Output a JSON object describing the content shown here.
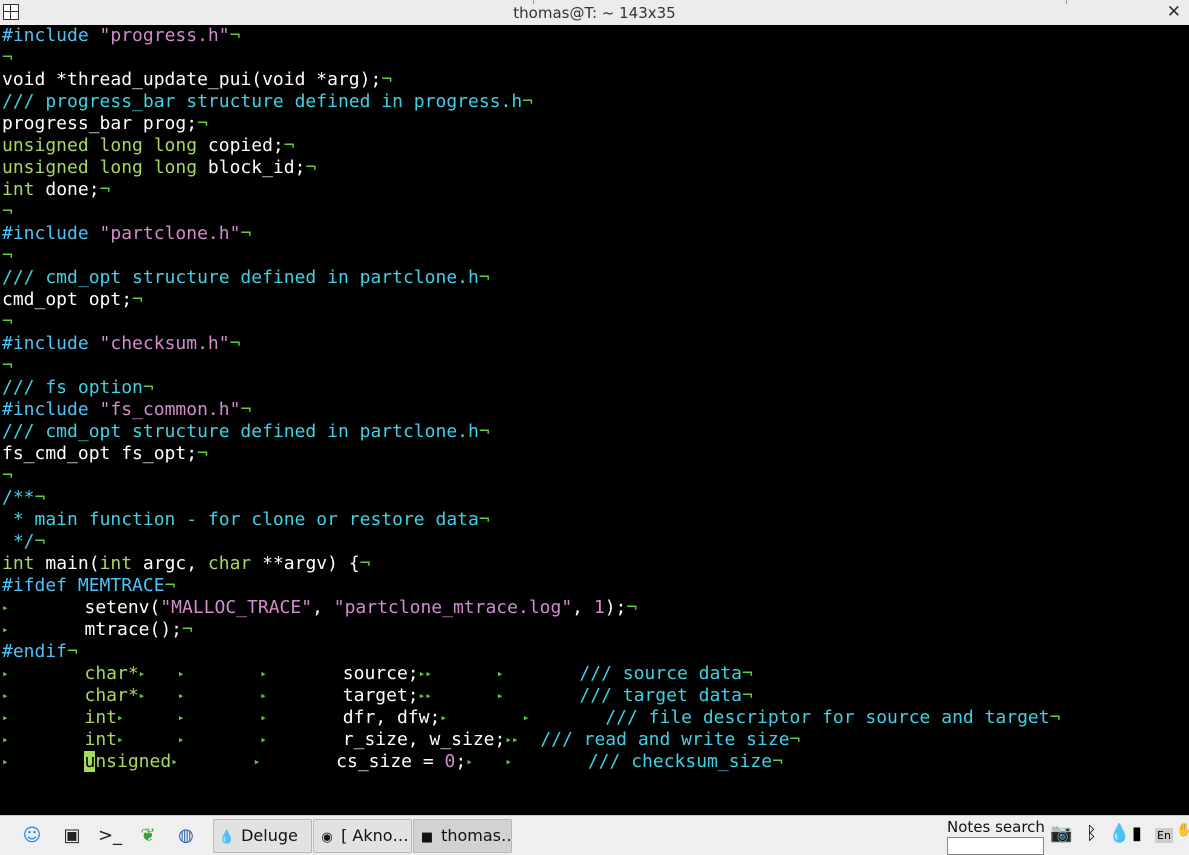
{
  "window": {
    "title": "thomas@T: ~ 143x35"
  },
  "editor": {
    "lines": [
      {
        "segs": [
          {
            "t": "#include ",
            "c": "pp"
          },
          {
            "t": "\"progress.h\"",
            "c": "str"
          },
          {
            "t": "¬",
            "c": "nl"
          }
        ]
      },
      {
        "segs": [
          {
            "t": "¬",
            "c": "nl"
          }
        ]
      },
      {
        "segs": [
          {
            "t": "void *thread_update_pui(void *arg);",
            "c": ""
          },
          {
            "t": "¬",
            "c": "nl"
          }
        ]
      },
      {
        "segs": [
          {
            "t": "/// progress_bar structure defined in progress.h",
            "c": "cm"
          },
          {
            "t": "¬",
            "c": "nl"
          }
        ]
      },
      {
        "segs": [
          {
            "t": "progress_bar prog;",
            "c": ""
          },
          {
            "t": "¬",
            "c": "nl"
          }
        ]
      },
      {
        "segs": [
          {
            "t": "unsigned long long",
            "c": "ty"
          },
          {
            "t": " copied;",
            "c": ""
          },
          {
            "t": "¬",
            "c": "nl"
          }
        ]
      },
      {
        "segs": [
          {
            "t": "unsigned long long",
            "c": "ty"
          },
          {
            "t": " block_id;",
            "c": ""
          },
          {
            "t": "¬",
            "c": "nl"
          }
        ]
      },
      {
        "segs": [
          {
            "t": "int",
            "c": "ty"
          },
          {
            "t": " done;",
            "c": ""
          },
          {
            "t": "¬",
            "c": "nl"
          }
        ]
      },
      {
        "segs": [
          {
            "t": "¬",
            "c": "nl"
          }
        ]
      },
      {
        "segs": [
          {
            "t": "#include ",
            "c": "pp"
          },
          {
            "t": "\"partclone.h\"",
            "c": "str"
          },
          {
            "t": "¬",
            "c": "nl"
          }
        ]
      },
      {
        "segs": [
          {
            "t": "¬",
            "c": "nl"
          }
        ]
      },
      {
        "segs": [
          {
            "t": "/// cmd_opt structure defined in partclone.h",
            "c": "cm"
          },
          {
            "t": "¬",
            "c": "nl"
          }
        ]
      },
      {
        "segs": [
          {
            "t": "cmd_opt opt;",
            "c": ""
          },
          {
            "t": "¬",
            "c": "nl"
          }
        ]
      },
      {
        "segs": [
          {
            "t": "¬",
            "c": "nl"
          }
        ]
      },
      {
        "segs": [
          {
            "t": "#include ",
            "c": "pp"
          },
          {
            "t": "\"checksum.h\"",
            "c": "str"
          },
          {
            "t": "¬",
            "c": "nl"
          }
        ]
      },
      {
        "segs": [
          {
            "t": "¬",
            "c": "nl"
          }
        ]
      },
      {
        "segs": [
          {
            "t": "/// fs option",
            "c": "cm"
          },
          {
            "t": "¬",
            "c": "nl"
          }
        ]
      },
      {
        "segs": [
          {
            "t": "#include ",
            "c": "pp"
          },
          {
            "t": "\"fs_common.h\"",
            "c": "str"
          },
          {
            "t": "¬",
            "c": "nl"
          }
        ]
      },
      {
        "segs": [
          {
            "t": "/// cmd_opt structure defined in partclone.h",
            "c": "cm"
          },
          {
            "t": "¬",
            "c": "nl"
          }
        ]
      },
      {
        "segs": [
          {
            "t": "fs_cmd_opt fs_opt;",
            "c": ""
          },
          {
            "t": "¬",
            "c": "nl"
          }
        ]
      },
      {
        "segs": [
          {
            "t": "¬",
            "c": "nl"
          }
        ]
      },
      {
        "segs": [
          {
            "t": "/**",
            "c": "cm"
          },
          {
            "t": "¬",
            "c": "nl"
          }
        ]
      },
      {
        "segs": [
          {
            "t": " * main function - for clone or restore data",
            "c": "cm"
          },
          {
            "t": "¬",
            "c": "nl"
          }
        ]
      },
      {
        "segs": [
          {
            "t": " */",
            "c": "cm"
          },
          {
            "t": "¬",
            "c": "nl"
          }
        ]
      },
      {
        "segs": [
          {
            "t": "int",
            "c": "ty"
          },
          {
            "t": " main(",
            "c": ""
          },
          {
            "t": "int",
            "c": "ty"
          },
          {
            "t": " argc, ",
            "c": ""
          },
          {
            "t": "char",
            "c": "ty"
          },
          {
            "t": " **argv) {",
            "c": ""
          },
          {
            "t": "¬",
            "c": "nl"
          }
        ]
      },
      {
        "segs": [
          {
            "t": "#ifdef MEMTRACE",
            "c": "pp"
          },
          {
            "t": "¬",
            "c": "nl"
          }
        ]
      },
      {
        "segs": [
          {
            "t": "▸",
            "c": "tb"
          },
          {
            "t": "       setenv(",
            "c": ""
          },
          {
            "t": "\"MALLOC_TRACE\"",
            "c": "str"
          },
          {
            "t": ", ",
            "c": ""
          },
          {
            "t": "\"partclone_mtrace.log\"",
            "c": "str"
          },
          {
            "t": ", ",
            "c": ""
          },
          {
            "t": "1",
            "c": "num"
          },
          {
            "t": ");",
            "c": ""
          },
          {
            "t": "¬",
            "c": "nl"
          }
        ]
      },
      {
        "segs": [
          {
            "t": "▸",
            "c": "tb"
          },
          {
            "t": "       mtrace();",
            "c": ""
          },
          {
            "t": "¬",
            "c": "nl"
          }
        ]
      },
      {
        "segs": [
          {
            "t": "#endif",
            "c": "pp"
          },
          {
            "t": "¬",
            "c": "nl"
          }
        ]
      },
      {
        "segs": [
          {
            "t": "▸",
            "c": "tb"
          },
          {
            "t": "       ",
            "c": ""
          },
          {
            "t": "char*",
            "c": "ty"
          },
          {
            "t": "▸",
            "c": "tb"
          },
          {
            "t": "   ",
            "c": ""
          },
          {
            "t": "▸",
            "c": "tb"
          },
          {
            "t": "       ",
            "c": ""
          },
          {
            "t": "▸",
            "c": "tb"
          },
          {
            "t": "       source;",
            "c": ""
          },
          {
            "t": "▸▸",
            "c": "tb"
          },
          {
            "t": "      ",
            "c": ""
          },
          {
            "t": "▸",
            "c": "tb"
          },
          {
            "t": "       ",
            "c": ""
          },
          {
            "t": "/// source data",
            "c": "cm"
          },
          {
            "t": "¬",
            "c": "nl"
          }
        ]
      },
      {
        "segs": [
          {
            "t": "▸",
            "c": "tb"
          },
          {
            "t": "       ",
            "c": ""
          },
          {
            "t": "char*",
            "c": "ty"
          },
          {
            "t": "▸",
            "c": "tb"
          },
          {
            "t": "   ",
            "c": ""
          },
          {
            "t": "▸",
            "c": "tb"
          },
          {
            "t": "       ",
            "c": ""
          },
          {
            "t": "▸",
            "c": "tb"
          },
          {
            "t": "       target;",
            "c": ""
          },
          {
            "t": "▸▸",
            "c": "tb"
          },
          {
            "t": "      ",
            "c": ""
          },
          {
            "t": "▸",
            "c": "tb"
          },
          {
            "t": "       ",
            "c": ""
          },
          {
            "t": "/// target data",
            "c": "cm"
          },
          {
            "t": "¬",
            "c": "nl"
          }
        ]
      },
      {
        "segs": [
          {
            "t": "▸",
            "c": "tb"
          },
          {
            "t": "       ",
            "c": ""
          },
          {
            "t": "int",
            "c": "ty"
          },
          {
            "t": "▸",
            "c": "tb"
          },
          {
            "t": "     ",
            "c": ""
          },
          {
            "t": "▸",
            "c": "tb"
          },
          {
            "t": "       ",
            "c": ""
          },
          {
            "t": "▸",
            "c": "tb"
          },
          {
            "t": "       dfr, dfw;",
            "c": ""
          },
          {
            "t": "▸",
            "c": "tb"
          },
          {
            "t": "       ",
            "c": ""
          },
          {
            "t": "▸",
            "c": "tb"
          },
          {
            "t": "       ",
            "c": ""
          },
          {
            "t": "/// file descriptor for source and target",
            "c": "cm"
          },
          {
            "t": "¬",
            "c": "nl"
          }
        ]
      },
      {
        "segs": [
          {
            "t": "▸",
            "c": "tb"
          },
          {
            "t": "       ",
            "c": ""
          },
          {
            "t": "int",
            "c": "ty"
          },
          {
            "t": "▸",
            "c": "tb"
          },
          {
            "t": "     ",
            "c": ""
          },
          {
            "t": "▸",
            "c": "tb"
          },
          {
            "t": "       ",
            "c": ""
          },
          {
            "t": "▸",
            "c": "tb"
          },
          {
            "t": "       r_size, w_size;",
            "c": ""
          },
          {
            "t": "▸▸",
            "c": "tb"
          },
          {
            "t": "  ",
            "c": ""
          },
          {
            "t": "/// read and write size",
            "c": "cm"
          },
          {
            "t": "¬",
            "c": "nl"
          }
        ]
      },
      {
        "segs": [
          {
            "t": "▸",
            "c": "tb"
          },
          {
            "t": "       ",
            "c": ""
          },
          {
            "t": "u",
            "c": "cur"
          },
          {
            "t": "nsigned",
            "c": "ty"
          },
          {
            "t": "▸",
            "c": "tb"
          },
          {
            "t": "       ",
            "c": ""
          },
          {
            "t": "▸",
            "c": "tb"
          },
          {
            "t": "       cs_size = ",
            "c": ""
          },
          {
            "t": "0",
            "c": "num"
          },
          {
            "t": ";",
            "c": ""
          },
          {
            "t": "▸",
            "c": "tb"
          },
          {
            "t": "   ",
            "c": ""
          },
          {
            "t": "▸",
            "c": "tb"
          },
          {
            "t": "       ",
            "c": ""
          },
          {
            "t": "/// checksum_size",
            "c": "cm"
          },
          {
            "t": "¬",
            "c": "nl"
          }
        ]
      }
    ]
  },
  "taskbar": {
    "launchers": [
      {
        "name": "kde-menu-icon",
        "glyph": "☺",
        "color": "#1e88e5"
      },
      {
        "name": "desktop-icon",
        "glyph": "▣",
        "color": "#222"
      },
      {
        "name": "terminal-icon",
        "glyph": ">_",
        "color": "#222"
      },
      {
        "name": "gecko-icon",
        "glyph": "❦",
        "color": "#3c9d3c"
      },
      {
        "name": "globe-icon",
        "glyph": "◍",
        "color": "#2a5db0"
      }
    ],
    "tasks": [
      {
        "label": "Deluge",
        "icon": "💧",
        "icon_name": "deluge-icon",
        "active": false
      },
      {
        "label": "[ Akno…",
        "icon": "◉",
        "icon_name": "akregator-icon",
        "active": false
      },
      {
        "label": "thomas…",
        "icon": "■",
        "icon_name": "terminal-task-icon",
        "active": true
      }
    ],
    "notes_search_label": "Notes search",
    "notes_search_value": "",
    "tray": [
      {
        "name": "camera-icon",
        "glyph": "📷"
      },
      {
        "name": "bluetooth-icon",
        "glyph": "ᛒ"
      },
      {
        "name": "droplet-icon",
        "glyph": "💧"
      },
      {
        "name": "battery-icon",
        "glyph": "▮"
      },
      {
        "name": "keyboard-layout-icon",
        "glyph": "En"
      },
      {
        "name": "hand-icon",
        "glyph": "✋"
      }
    ]
  },
  "colors": {
    "background": "#000000",
    "preprocessor": "#4fc3f7",
    "string": "#d18ccc",
    "comment": "#3fd2e6",
    "type": "#a7d95f",
    "listchars": "#5fcf3a"
  }
}
